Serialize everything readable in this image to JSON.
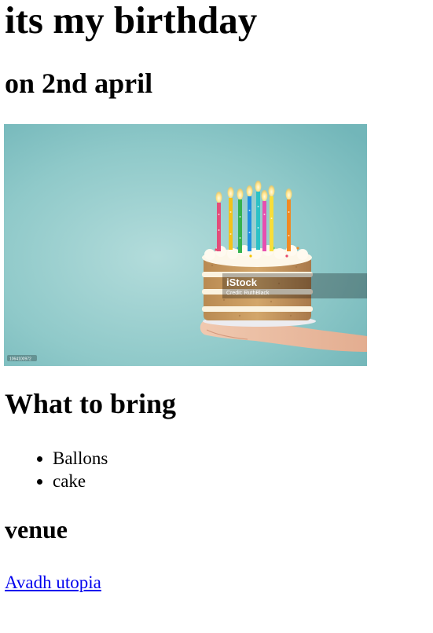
{
  "header": {
    "title": "its my birthday",
    "subtitle": "on 2nd april"
  },
  "hero_image": {
    "watermark_brand": "iStock",
    "watermark_credit": "Credit: RuthBlack",
    "corner_tag": "1064100972",
    "colors": {
      "background": "#8cc8c8",
      "cake_layer": "#c79a5e",
      "frosting": "#fdf6e8"
    }
  },
  "bring": {
    "heading": "What to bring",
    "items": [
      "Ballons",
      "cake"
    ]
  },
  "venue": {
    "heading": "venue",
    "link_text": "Avadh utopia"
  }
}
